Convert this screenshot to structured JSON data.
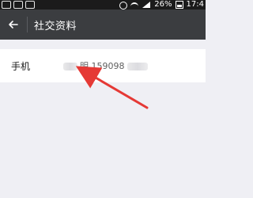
{
  "status_bar": {
    "battery_percent": "26%",
    "time": "17:4"
  },
  "nav": {
    "title": "社交资料"
  },
  "row": {
    "label": "手机",
    "value": "明 159098"
  },
  "colors": {
    "status_bar_bg": "#1b1b1b",
    "nav_bg": "#3b3d40",
    "page_bg": "#efeff4",
    "row_bg": "#ffffff",
    "annotation_arrow": "#e53935"
  }
}
